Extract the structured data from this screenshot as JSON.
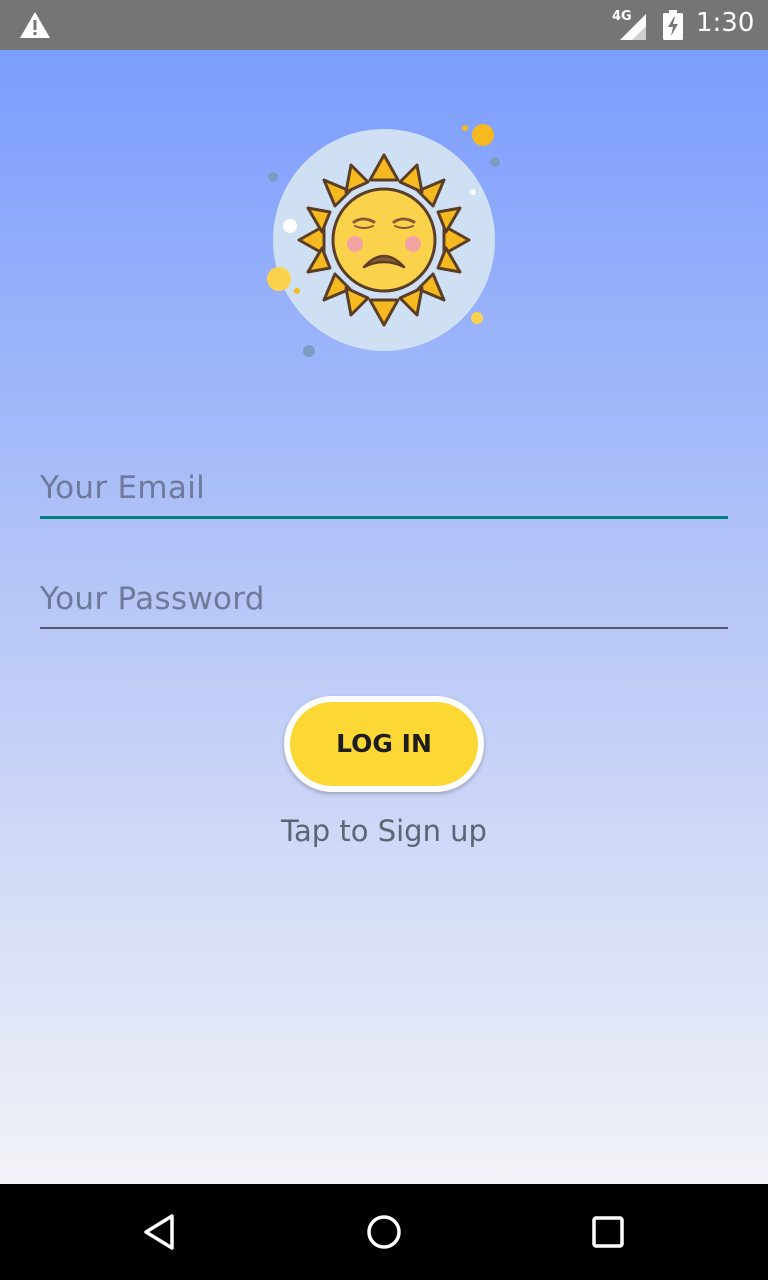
{
  "status_bar": {
    "network": "4G",
    "time": "1:30",
    "icons": [
      "warning-icon",
      "signal-icon",
      "battery-charging-icon"
    ]
  },
  "logo": {
    "icon": "sad-sun-icon"
  },
  "login_form": {
    "email_placeholder": "Your Email",
    "password_placeholder": "Your Password",
    "login_label": "LOG IN",
    "signup_label": "Tap to Sign up"
  },
  "navigation_bar": {
    "icons": [
      "back-icon",
      "home-icon",
      "recents-icon"
    ]
  },
  "colors": {
    "status_bar": "#757575",
    "gradient_top": "#7b9dfd",
    "gradient_bottom": "#f2f3f7",
    "button": "#fdd835",
    "focus_underline": "#00827a"
  }
}
